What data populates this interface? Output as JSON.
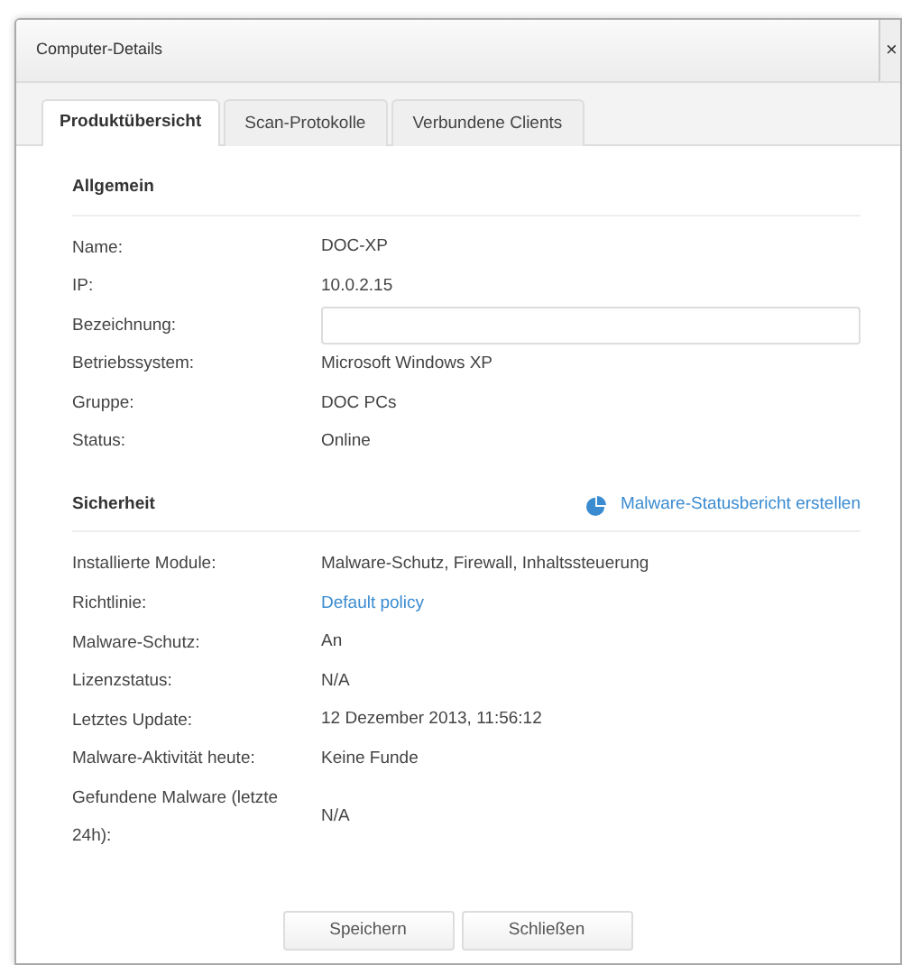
{
  "window": {
    "title": "Computer-Details",
    "close": "×"
  },
  "tabs": [
    {
      "label": "Produktübersicht",
      "selected": true
    },
    {
      "label": "Scan-Protokolle",
      "selected": false
    },
    {
      "label": "Verbundene Clients",
      "selected": false
    }
  ],
  "sections": [
    {
      "title": "Allgemein",
      "rows": [
        {
          "kind": "text",
          "label": "Name:",
          "value": "DOC-XP"
        },
        {
          "kind": "text",
          "label": "IP:",
          "value": "10.0.2.15"
        },
        {
          "kind": "field",
          "label": "Bezeichnung:"
        },
        {
          "kind": "text",
          "label": "Betriebssystem:",
          "value": "Microsoft Windows XP"
        },
        {
          "kind": "text",
          "label": "Gruppe:",
          "value": "DOC PCs"
        },
        {
          "kind": "text",
          "label": "Status:",
          "value": "Online"
        }
      ]
    },
    {
      "title": "Sicherheit",
      "action": "Malware-Statusbericht erstellen",
      "rows": [
        {
          "kind": "text",
          "label": "Installierte Module:",
          "value": "Malware-Schutz, Firewall, Inhaltssteuerung"
        },
        {
          "kind": "link",
          "label": "Richtlinie:",
          "value": "Default policy"
        },
        {
          "kind": "text",
          "label": "Malware-Schutz:",
          "value": "An"
        },
        {
          "kind": "text",
          "label": "Lizenzstatus:",
          "value": "N/A"
        },
        {
          "kind": "text",
          "label": "Letztes Update:",
          "value": "12 Dezember 2013, 11:56:12"
        },
        {
          "kind": "text",
          "label": "Malware-Aktivität heute:",
          "value": "Keine Funde"
        },
        {
          "kind": "text",
          "label": "Gefundene Malware (letzte 24h):",
          "value": "N/A"
        }
      ]
    }
  ],
  "buttons": [
    "Speichern",
    "Schließen"
  ]
}
